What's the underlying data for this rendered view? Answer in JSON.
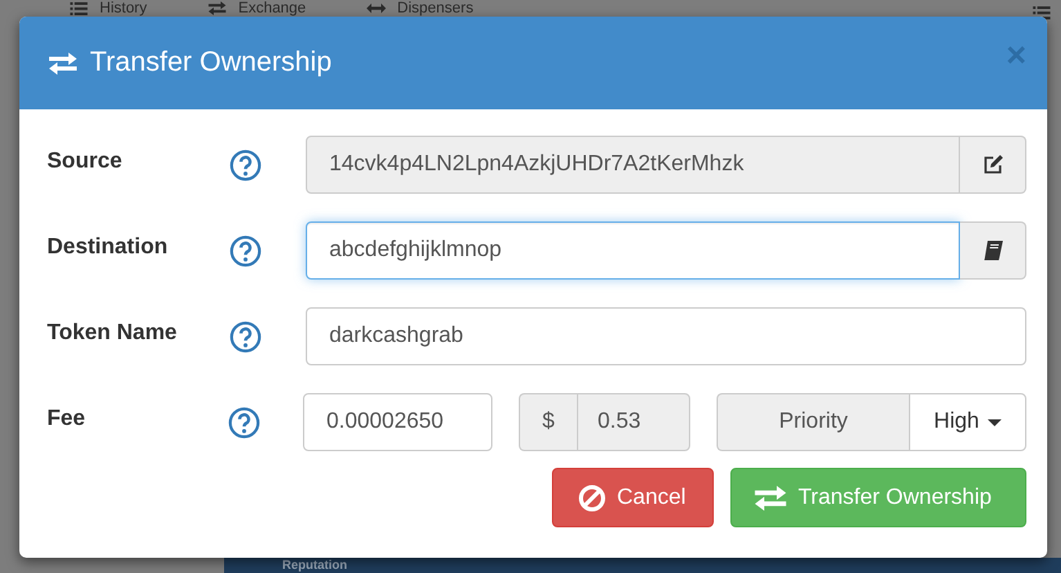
{
  "background": {
    "nav": [
      {
        "kind": "list",
        "label": "History"
      },
      {
        "kind": "swap",
        "label": "Exchange"
      },
      {
        "kind": "leftright",
        "label": "Dispensers"
      }
    ],
    "panel_title": "Reputation"
  },
  "dialog": {
    "title": "Transfer Ownership",
    "close": "×",
    "fields": [
      {
        "kind": "edit-addon",
        "label": "Source",
        "value": "14cvk4p4LN2Lpn4AzkjUHDr7A2tKerMhzk",
        "disabled": true,
        "focused": false
      },
      {
        "kind": "book-addon",
        "label": "Destination",
        "value": "abcdefghijklmnop",
        "disabled": false,
        "focused": true
      },
      {
        "kind": "text",
        "label": "Token Name",
        "value": "darkcashgrab",
        "disabled": false,
        "focused": false
      },
      {
        "kind": "fee",
        "label": "Fee",
        "value": "0.00002650",
        "currency_symbol": "$",
        "fiat_value": "0.53",
        "priority_label": "Priority",
        "priority_value": "High"
      }
    ],
    "buttons": [
      {
        "kind": "cancel",
        "label": "Cancel"
      },
      {
        "kind": "confirm",
        "label": "Transfer Ownership"
      }
    ]
  }
}
